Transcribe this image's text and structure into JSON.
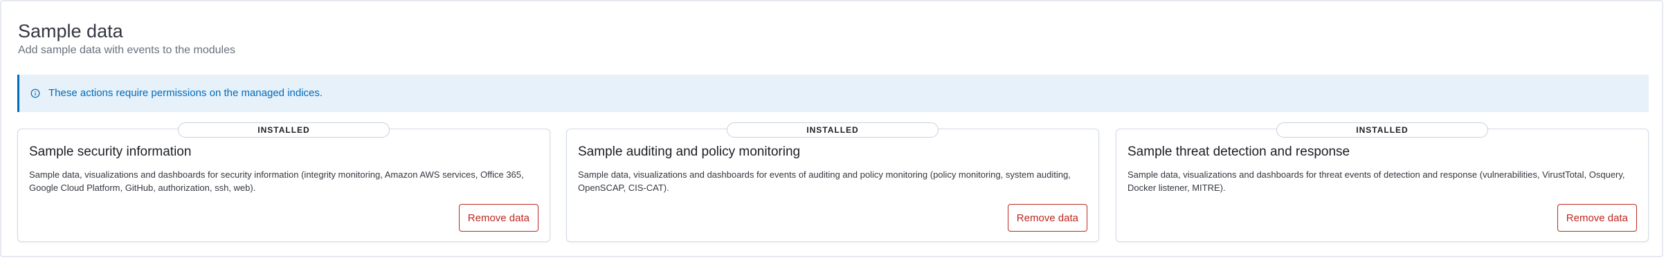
{
  "header": {
    "title": "Sample data",
    "subtitle": "Add sample data with events to the modules"
  },
  "callout": {
    "icon": "info-icon",
    "text": "These actions require permissions on the managed indices.",
    "accent_color": "#006bb8",
    "background_color": "#e6f1fa"
  },
  "cards": [
    {
      "badge": "INSTALLED",
      "title": "Sample security information",
      "description": "Sample data, visualizations and dashboards for security information (integrity monitoring, Amazon AWS services, Office 365, Google Cloud Platform, GitHub, authorization, ssh, web).",
      "button_label": "Remove data"
    },
    {
      "badge": "INSTALLED",
      "title": "Sample auditing and policy monitoring",
      "description": "Sample data, visualizations and dashboards for events of auditing and policy monitoring (policy monitoring, system auditing, OpenSCAP, CIS-CAT).",
      "button_label": "Remove data"
    },
    {
      "badge": "INSTALLED",
      "title": "Sample threat detection and response",
      "description": "Sample data, visualizations and dashboards for threat events of detection and response (vulnerabilities, VirustTotal, Osquery, Docker listener, MITRE).",
      "button_label": "Remove data"
    }
  ],
  "colors": {
    "danger": "#bd271e",
    "text": "#343741"
  }
}
